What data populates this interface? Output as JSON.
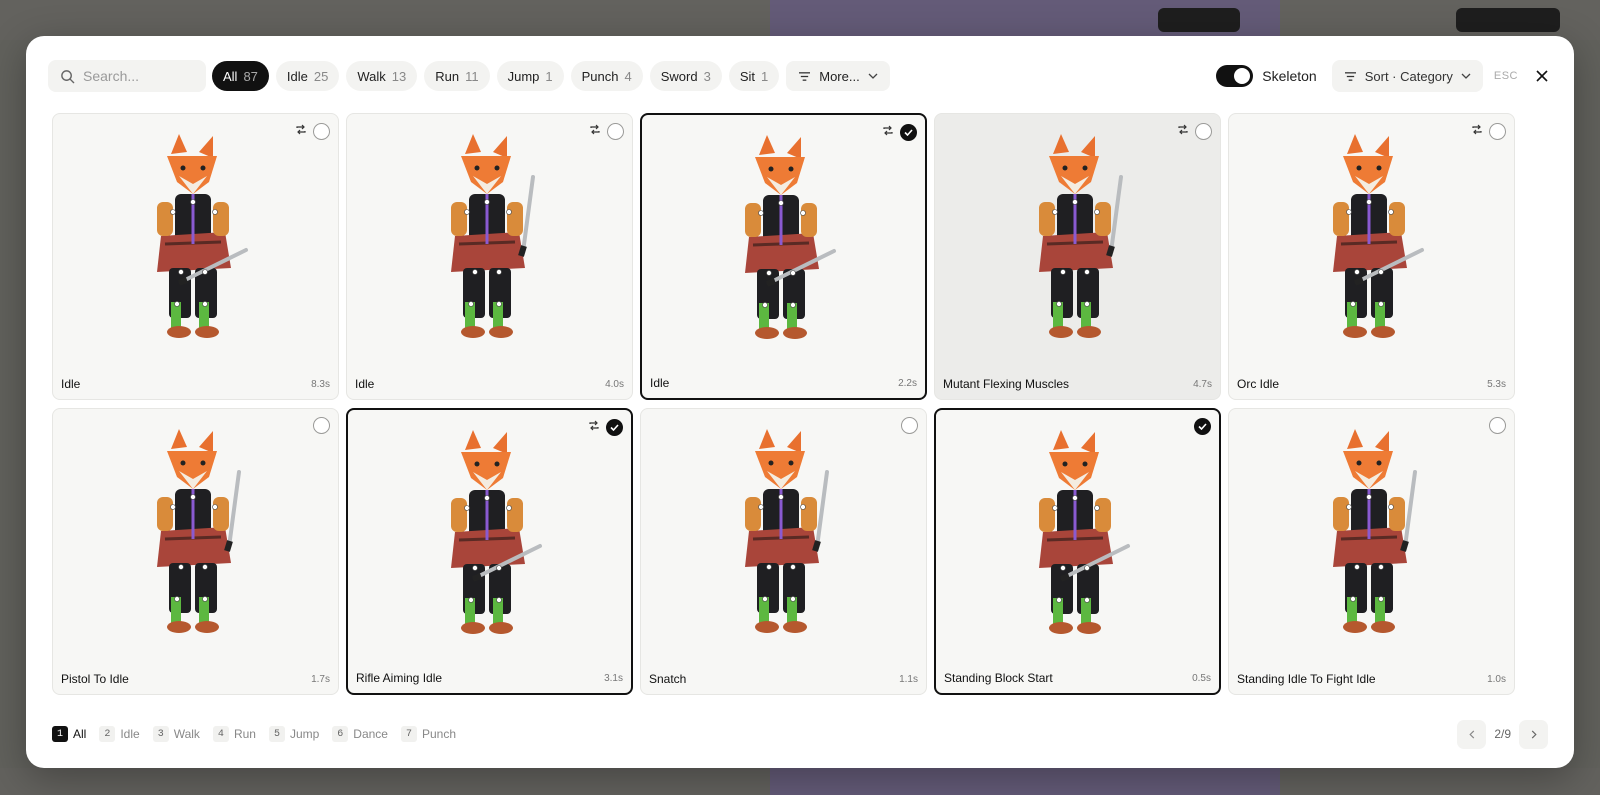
{
  "search": {
    "placeholder": "Search..."
  },
  "filters": [
    {
      "label": "All",
      "count": "87",
      "active": true
    },
    {
      "label": "Idle",
      "count": "25"
    },
    {
      "label": "Walk",
      "count": "13"
    },
    {
      "label": "Run",
      "count": "11"
    },
    {
      "label": "Jump",
      "count": "1"
    },
    {
      "label": "Punch",
      "count": "4"
    },
    {
      "label": "Sword",
      "count": "3"
    },
    {
      "label": "Sit",
      "count": "1"
    }
  ],
  "more_label": "More...",
  "skeleton_label": "Skeleton",
  "skeleton_on": true,
  "sort_label": "Sort · Category",
  "esc_label": "ESC",
  "animations": [
    {
      "name": "Idle",
      "duration": "8.3s",
      "loop": true,
      "selected": false
    },
    {
      "name": "Idle",
      "duration": "4.0s",
      "loop": true,
      "selected": false
    },
    {
      "name": "Idle",
      "duration": "2.2s",
      "loop": true,
      "selected": true
    },
    {
      "name": "Mutant Flexing Muscles",
      "duration": "4.7s",
      "loop": true,
      "selected": false
    },
    {
      "name": "Orc Idle",
      "duration": "5.3s",
      "loop": true,
      "selected": false
    },
    {
      "name": "Pistol To Idle",
      "duration": "1.7s",
      "loop": false,
      "selected": false
    },
    {
      "name": "Rifle Aiming Idle",
      "duration": "3.1s",
      "loop": true,
      "selected": true
    },
    {
      "name": "Snatch",
      "duration": "1.1s",
      "loop": false,
      "selected": false
    },
    {
      "name": "Standing Block Start",
      "duration": "0.5s",
      "loop": false,
      "selected": true
    },
    {
      "name": "Standing Idle To Fight Idle",
      "duration": "1.0s",
      "loop": false,
      "selected": false
    }
  ],
  "categories": [
    {
      "key": "1",
      "label": "All",
      "active": true
    },
    {
      "key": "2",
      "label": "Idle"
    },
    {
      "key": "3",
      "label": "Walk"
    },
    {
      "key": "4",
      "label": "Run"
    },
    {
      "key": "5",
      "label": "Jump"
    },
    {
      "key": "6",
      "label": "Dance"
    },
    {
      "key": "7",
      "label": "Punch"
    }
  ],
  "pagination": {
    "text": "2/9"
  }
}
